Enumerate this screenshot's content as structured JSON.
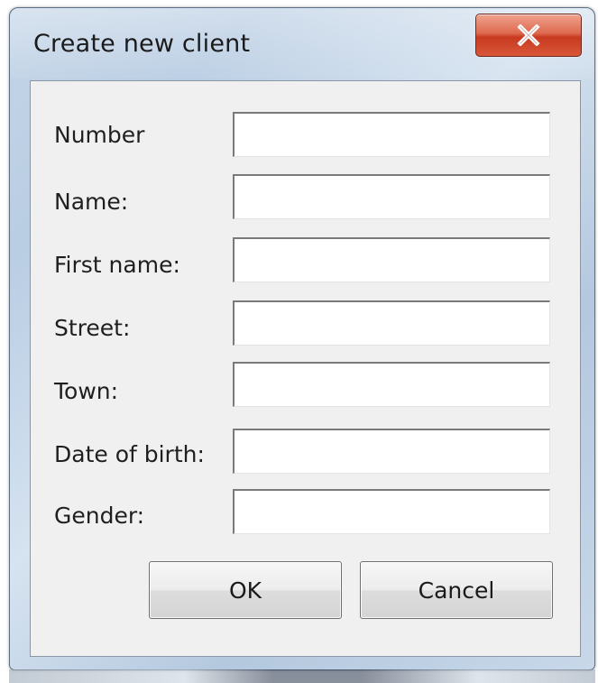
{
  "window": {
    "title": "Create new client",
    "close_glyph": "close-icon"
  },
  "form": {
    "fields": [
      {
        "label": "Number",
        "value": ""
      },
      {
        "label": "Name:",
        "value": ""
      },
      {
        "label": "First name:",
        "value": ""
      },
      {
        "label": "Street:",
        "value": ""
      },
      {
        "label": "Town:",
        "value": ""
      },
      {
        "label": "Date of birth:",
        "value": ""
      },
      {
        "label": "Gender:",
        "value": ""
      }
    ]
  },
  "buttons": {
    "ok_label": "OK",
    "cancel_label": "Cancel"
  },
  "colors": {
    "close_button": "#c83a1f",
    "client_area": "#f0f0f0",
    "frame": "#c4d5e7"
  }
}
